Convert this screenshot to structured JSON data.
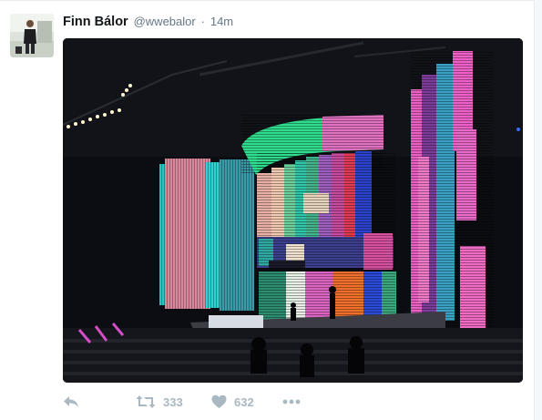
{
  "tweet": {
    "author": {
      "display_name": "Finn Bálor",
      "handle": "@wwebalor",
      "avatar_icon": "user-avatar-photo"
    },
    "separator": "·",
    "timestamp": "14m",
    "media": {
      "kind": "photo",
      "subject": "arena stage with LED color-bar video walls"
    },
    "actions": {
      "reply_icon": "reply-icon",
      "retweet_icon": "retweet-icon",
      "retweet_count": "333",
      "like_icon": "heart-icon",
      "like_count": "632",
      "more_icon": "more-icon"
    }
  },
  "colors": {
    "name": "#14171a",
    "meta": "#657786",
    "action": "#aab8c2",
    "border": "#e6ecf0"
  }
}
